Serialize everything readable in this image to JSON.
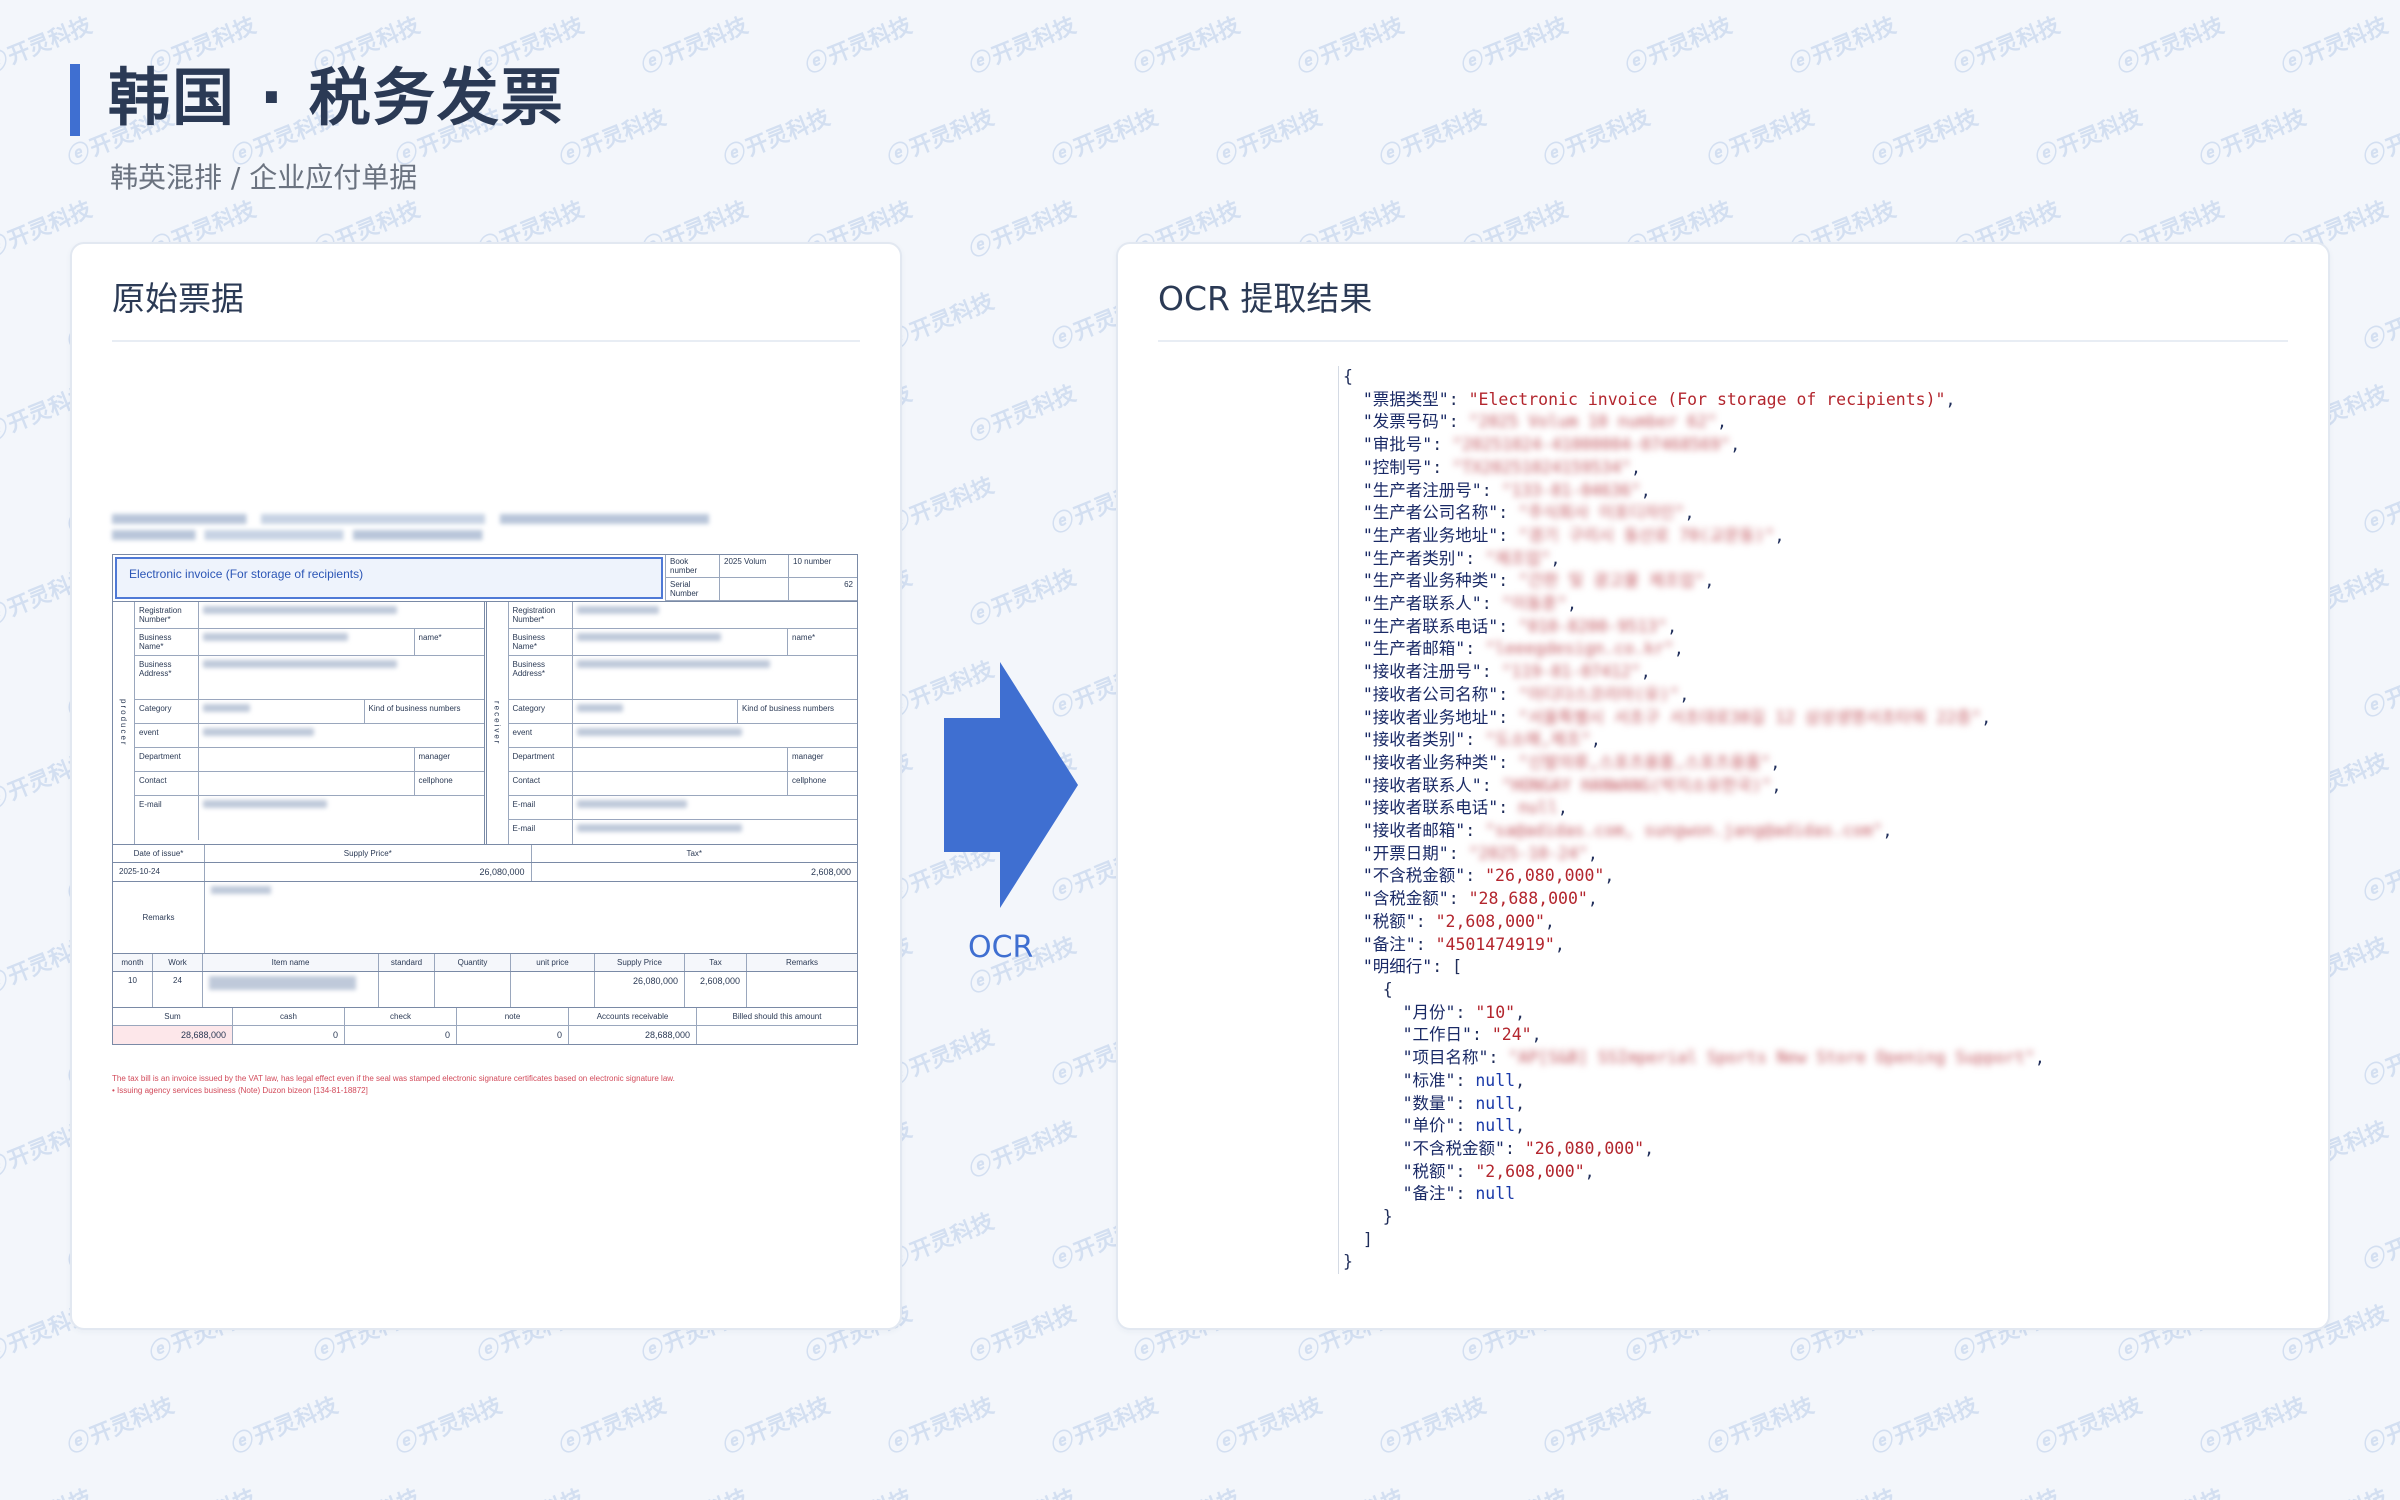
{
  "header": {
    "title": "韩国 · 税务发票",
    "subtitle": "韩英混排 / 企业应付单据"
  },
  "left_panel": {
    "title": "原始票据"
  },
  "right_panel": {
    "title": "OCR 提取结果"
  },
  "arrow": {
    "label": "OCR",
    "color": "#3f6fd1"
  },
  "watermark": {
    "text": "开灵科技"
  },
  "invoice": {
    "title": "Electronic invoice (For storage of recipients)",
    "book_number_label": "Book number",
    "book_volume": "2025 Volum",
    "book_no_label": "10 number",
    "serial_number_label": "Serial Number",
    "serial_number": "62",
    "producer_side": "producer",
    "receiver_side": "receiver",
    "labels": {
      "registration": "Registration Number*",
      "business_name": "Business Name*",
      "name": "name*",
      "business_address": "Business Address*",
      "category": "Category",
      "kind": "Kind of business numbers",
      "event": "event",
      "department": "Department",
      "manager": "manager",
      "contact": "Contact",
      "cellphone": "cellphone",
      "email": "E-mail",
      "date_of_issue": "Date of issue*",
      "supply_price": "Supply Price*",
      "tax": "Tax*",
      "remarks": "Remarks",
      "month": "month",
      "work": "Work",
      "item_name": "Item name",
      "standard": "standard",
      "quantity": "Quantity",
      "unit_price": "unit price",
      "supply_price_col": "Supply Price",
      "tax_col": "Tax",
      "remarks_col": "Remarks",
      "sum": "Sum",
      "cash": "cash",
      "check": "check",
      "note": "note",
      "accounts_receivable": "Accounts receivable",
      "billed": "Billed should this amount"
    },
    "date_of_issue": "2025-10-24",
    "supply_price": "26,080,000",
    "tax": "2,608,000",
    "line": {
      "month": "10",
      "work": "24",
      "supply_price": "26,080,000",
      "tax": "2,608,000"
    },
    "totals": {
      "sum": "28,688,000",
      "cash": "0",
      "check": "0",
      "note": "0",
      "accounts_receivable": "28,688,000"
    },
    "footnote_1": "The tax bill is an invoice issued by the VAT law, has legal effect even if the seal was stamped electronic signature certificates based on electronic signature law.",
    "footnote_2": "• Issuing agency services business (Note) Duzon bizeon [134-81-18872]"
  },
  "ocr_json": {
    "open_brace": "{",
    "close_brace": "}",
    "fields": [
      {
        "key": "票据类型",
        "value": "Electronic invoice (For storage of recipients)",
        "type": "string",
        "blurred": false
      },
      {
        "key": "发票号码",
        "value": "2025 Volum 10 number 62",
        "type": "string",
        "blurred": true
      },
      {
        "key": "审批号",
        "value": "20251024-41000004-07468569",
        "type": "string",
        "blurred": true
      },
      {
        "key": "控制号",
        "value": "TX20251024159534",
        "type": "string",
        "blurred": true
      },
      {
        "key": "生产者注册号",
        "value": "133-81-04636",
        "type": "string",
        "blurred": true
      },
      {
        "key": "生产者公司名称",
        "value": "주식회사 이포디자인",
        "type": "string",
        "blurred": true
      },
      {
        "key": "生产者业务地址",
        "value": "경기 구리시 동산로 70(교문동)",
        "type": "string",
        "blurred": true
      },
      {
        "key": "生产者类别",
        "value": "제조업",
        "type": "string",
        "blurred": true
      },
      {
        "key": "生产者业务种类",
        "value": "간판 및 광고물 제조업",
        "type": "string",
        "blurred": true
      },
      {
        "key": "生产者联系人",
        "value": "이동훈",
        "type": "string",
        "blurred": true
      },
      {
        "key": "生产者联系电话",
        "value": "010-8200-9513",
        "type": "string",
        "blurred": true
      },
      {
        "key": "生产者邮箱",
        "value": "leeegdesign.co.kr",
        "type": "string",
        "blurred": true
      },
      {
        "key": "接收者注册号",
        "value": "119-81-07412",
        "type": "string",
        "blurred": true
      },
      {
        "key": "接收者公司名称",
        "value": "아디다스코리아(유)",
        "type": "string",
        "blurred": true
      },
      {
        "key": "接收者业务地址",
        "value": "서울특별시 서초구 서초대로38길 12 삼성생명서초타워 22층",
        "type": "string",
        "blurred": true
      },
      {
        "key": "接收者类别",
        "value": "도소매,제조",
        "type": "string",
        "blurred": true
      },
      {
        "key": "接收者业务种类",
        "value": "신발의류,스포츠용품,스포츠용품",
        "type": "string",
        "blurred": true
      },
      {
        "key": "接收者联系人",
        "value": "HONGAY HANWANG(박지소유한국)",
        "type": "string",
        "blurred": true
      },
      {
        "key": "接收者联系电话",
        "value": "null",
        "type": "null",
        "blurred": true
      },
      {
        "key": "接收者邮箱",
        "value": "sa@adidas.com, sungwon.jang@adidas.com",
        "type": "string",
        "blurred": true
      },
      {
        "key": "开票日期",
        "value": "2025-10-24",
        "type": "string",
        "blurred": true
      },
      {
        "key": "不含税金额",
        "value": "26,080,000",
        "type": "string",
        "blurred": false
      },
      {
        "key": "含税金额",
        "value": "28,688,000",
        "type": "string",
        "blurred": false
      },
      {
        "key": "税额",
        "value": "2,608,000",
        "type": "string",
        "blurred": false
      },
      {
        "key": "备注",
        "value": "4501474919",
        "type": "string",
        "blurred": false
      }
    ],
    "items_key": "明细行",
    "items": [
      [
        {
          "key": "月份",
          "value": "10",
          "type": "string",
          "blurred": false
        },
        {
          "key": "工作日",
          "value": "24",
          "type": "string",
          "blurred": false
        },
        {
          "key": "项目名称",
          "value": "AP[S&B] SSImperial Sports New Store Opening Support",
          "type": "string",
          "blurred": true
        },
        {
          "key": "标准",
          "value": "null",
          "type": "null",
          "blurred": false
        },
        {
          "key": "数量",
          "value": "null",
          "type": "null",
          "blurred": false
        },
        {
          "key": "单价",
          "value": "null",
          "type": "null",
          "blurred": false
        },
        {
          "key": "不含税金额",
          "value": "26,080,000",
          "type": "string",
          "blurred": false
        },
        {
          "key": "税额",
          "value": "2,608,000",
          "type": "string",
          "blurred": false
        },
        {
          "key": "备注",
          "value": "null",
          "type": "null",
          "blurred": false
        }
      ]
    ]
  }
}
